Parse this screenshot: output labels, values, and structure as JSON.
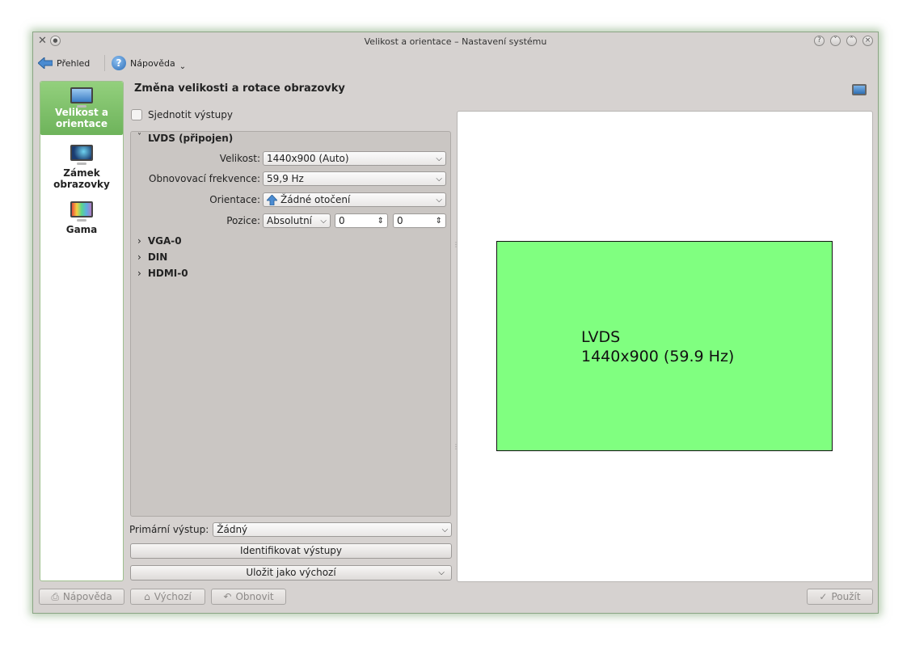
{
  "window": {
    "title": "Velikost a orientace – Nastavení systému"
  },
  "toolbar": {
    "overview_label": "Přehled",
    "help_label": "Nápověda"
  },
  "sidebar": {
    "items": [
      {
        "line1": "Velikost a",
        "line2": "orientace",
        "icon": "monitor-icon",
        "selected": true
      },
      {
        "line1": "Zámek",
        "line2": "obrazovky",
        "icon": "screen-lock-icon",
        "selected": false
      },
      {
        "line1": "Gama",
        "line2": "",
        "icon": "gamma-icon",
        "selected": false
      }
    ]
  },
  "main": {
    "heading": "Změna velikosti a rotace obrazovky",
    "unify_outputs": {
      "label": "Sjednotit výstupy",
      "checked": false
    },
    "outputs": [
      {
        "name": "LVDS (připojen)",
        "expanded": true
      },
      {
        "name": "VGA-0",
        "expanded": false
      },
      {
        "name": "DIN",
        "expanded": false
      },
      {
        "name": "HDMI-0",
        "expanded": false
      }
    ],
    "form": {
      "size_label": "Velikost:",
      "size_value": "1440x900 (Auto)",
      "refresh_label": "Obnovovací frekvence:",
      "refresh_value": "59,9 Hz",
      "orientation_label": "Orientace:",
      "orientation_value": "Žádné otočení",
      "position_label": "Pozice:",
      "position_mode": "Absolutní",
      "position_x": "0",
      "position_y": "0"
    },
    "primary_output_label": "Primární výstup:",
    "primary_output_value": "Žádný",
    "identify_button": "Identifikovat výstupy",
    "save_default_button": "Uložit jako výchozí"
  },
  "preview": {
    "output_name": "LVDS",
    "output_mode": "1440x900 (59.9 Hz)",
    "fill_color": "#80ff80"
  },
  "bottom": {
    "help": "Nápověda",
    "defaults": "Výchozí",
    "reset": "Obnovit",
    "apply": "Použít"
  },
  "colors": {
    "accent": "#6eb35b",
    "window_bg": "#d6d2d0"
  }
}
